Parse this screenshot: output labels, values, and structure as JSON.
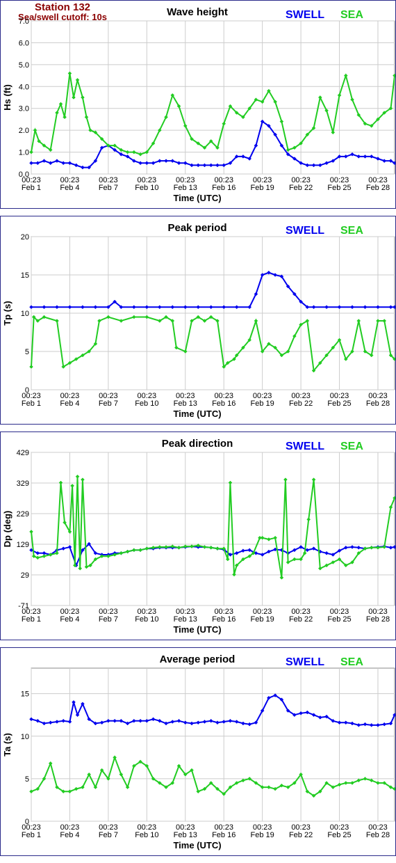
{
  "station": {
    "title": "Station 132",
    "cutoff": "Sea/swell cutoff: 10s"
  },
  "legend": {
    "swell": "SWELL",
    "sea": "SEA"
  },
  "colors": {
    "swell": "#0000ee",
    "sea": "#22cc22",
    "frame": "#2a2a8a",
    "grid": "#cccccc",
    "plot_bg": "#ffffff",
    "station": "#8b0000"
  },
  "x_ticks": [
    {
      "top": "00:23",
      "bottom": "Feb 1"
    },
    {
      "top": "00:23",
      "bottom": "Feb 4"
    },
    {
      "top": "00:23",
      "bottom": "Feb 7"
    },
    {
      "top": "00:23",
      "bottom": "Feb 10"
    },
    {
      "top": "00:23",
      "bottom": "Feb 13"
    },
    {
      "top": "00:23",
      "bottom": "Feb 16"
    },
    {
      "top": "00:23",
      "bottom": "Feb 19"
    },
    {
      "top": "00:23",
      "bottom": "Feb 22"
    },
    {
      "top": "00:23",
      "bottom": "Feb 25"
    },
    {
      "top": "00:23",
      "bottom": "Feb 28"
    }
  ],
  "chart_data": [
    {
      "type": "line",
      "title": "Wave height",
      "xlabel": "Time (UTC)",
      "ylabel": "Hs (ft)",
      "ylim": [
        0,
        7
      ],
      "yticks": [
        "0.0",
        "1.0",
        "2.0",
        "3.0",
        "4.0",
        "5.0",
        "6.0",
        "7.0"
      ],
      "xlim": [
        1,
        29.3
      ],
      "grid": true,
      "legend": "top-right",
      "series": [
        {
          "name": "SWELL",
          "x": [
            1,
            1.5,
            2,
            2.5,
            3,
            3.5,
            4,
            4.5,
            5,
            5.5,
            6,
            6.5,
            7,
            7.5,
            8,
            8.5,
            9,
            9.5,
            10,
            10.5,
            11,
            11.5,
            12,
            12.5,
            13,
            13.5,
            14,
            14.5,
            15,
            15.5,
            16,
            16.5,
            17,
            17.5,
            18,
            18.5,
            19,
            19.5,
            20,
            20.5,
            21,
            21.5,
            22,
            22.5,
            23,
            23.5,
            24,
            24.5,
            25,
            25.5,
            26,
            26.5,
            27,
            27.5,
            28,
            28.5,
            29,
            29.3
          ],
          "values": [
            0.5,
            0.5,
            0.6,
            0.5,
            0.6,
            0.5,
            0.5,
            0.4,
            0.3,
            0.3,
            0.6,
            1.2,
            1.3,
            1.1,
            0.9,
            0.8,
            0.6,
            0.5,
            0.5,
            0.5,
            0.6,
            0.6,
            0.6,
            0.5,
            0.5,
            0.4,
            0.4,
            0.4,
            0.4,
            0.4,
            0.4,
            0.5,
            0.8,
            0.8,
            0.7,
            1.3,
            2.4,
            2.2,
            1.8,
            1.3,
            0.9,
            0.7,
            0.5,
            0.4,
            0.4,
            0.4,
            0.5,
            0.6,
            0.8,
            0.8,
            0.9,
            0.8,
            0.8,
            0.8,
            0.7,
            0.6,
            0.6,
            0.5
          ]
        },
        {
          "name": "SEA",
          "x": [
            1,
            1.3,
            1.6,
            2,
            2.5,
            3,
            3.3,
            3.6,
            4,
            4.3,
            4.6,
            5,
            5.3,
            5.6,
            6,
            6.5,
            7,
            7.5,
            8,
            8.5,
            9,
            9.5,
            10,
            10.5,
            11,
            11.5,
            12,
            12.5,
            13,
            13.5,
            14,
            14.5,
            15,
            15.5,
            16,
            16.5,
            17,
            17.5,
            18,
            18.5,
            19,
            19.5,
            20,
            20.5,
            21,
            21.5,
            22,
            22.5,
            23,
            23.5,
            24,
            24.5,
            25,
            25.5,
            26,
            26.5,
            27,
            27.5,
            28,
            28.5,
            29,
            29.3
          ],
          "values": [
            1.0,
            2.0,
            1.5,
            1.3,
            1.1,
            2.8,
            3.2,
            2.6,
            4.6,
            3.5,
            4.3,
            3.5,
            2.6,
            2.0,
            1.9,
            1.6,
            1.3,
            1.3,
            1.1,
            1.0,
            1.0,
            0.9,
            1.0,
            1.4,
            2.0,
            2.6,
            3.6,
            3.1,
            2.2,
            1.6,
            1.4,
            1.2,
            1.5,
            1.2,
            2.3,
            3.1,
            2.8,
            2.6,
            3.0,
            3.4,
            3.3,
            3.8,
            3.3,
            2.4,
            1.1,
            1.2,
            1.4,
            1.8,
            2.1,
            3.5,
            2.9,
            1.9,
            3.6,
            4.5,
            3.4,
            2.7,
            2.3,
            2.2,
            2.5,
            2.8,
            3.0,
            4.5
          ]
        }
      ]
    },
    {
      "type": "line",
      "title": "Peak period",
      "xlabel": "Time (UTC)",
      "ylabel": "Tp (s)",
      "ylim": [
        0,
        20
      ],
      "yticks": [
        "0",
        "5",
        "10",
        "15",
        "20"
      ],
      "xlim": [
        1,
        29.3
      ],
      "grid": true,
      "legend": "top-right",
      "series": [
        {
          "name": "SWELL",
          "x": [
            1,
            2,
            3,
            4,
            5,
            6,
            7,
            7.5,
            8,
            9,
            10,
            11,
            12,
            13,
            14,
            15,
            16,
            17,
            18,
            18.5,
            19,
            19.5,
            20,
            20.5,
            21,
            21.5,
            22,
            22.5,
            23,
            24,
            25,
            26,
            27,
            28,
            29,
            29.3
          ],
          "values": [
            10.8,
            10.8,
            10.8,
            10.8,
            10.8,
            10.8,
            10.8,
            11.5,
            10.8,
            10.8,
            10.8,
            10.8,
            10.8,
            10.8,
            10.8,
            10.8,
            10.8,
            10.8,
            10.8,
            12.5,
            15.0,
            15.3,
            15.0,
            14.8,
            13.5,
            12.5,
            11.5,
            10.8,
            10.8,
            10.8,
            10.8,
            10.8,
            10.8,
            10.8,
            10.8,
            10.8
          ]
        },
        {
          "name": "SEA",
          "x": [
            1,
            1.2,
            1.5,
            2,
            3,
            3.5,
            4,
            4.5,
            5,
            5.5,
            6,
            6.3,
            7,
            8,
            9,
            10,
            11,
            11.5,
            12,
            12.3,
            13,
            13.5,
            14,
            14.5,
            15,
            15.5,
            16,
            16.3,
            16.8,
            17,
            17.5,
            18,
            18.5,
            19,
            19.5,
            20,
            20.5,
            21,
            21.5,
            22,
            22.5,
            23,
            23.5,
            24,
            24.5,
            25,
            25.5,
            26,
            26.5,
            27,
            27.5,
            28,
            28.5,
            29,
            29.3
          ],
          "values": [
            3.0,
            9.5,
            9.0,
            9.5,
            9.0,
            3.0,
            3.5,
            4.0,
            4.5,
            5.0,
            6.0,
            9.0,
            9.5,
            9.0,
            9.5,
            9.5,
            9.0,
            9.5,
            9.0,
            5.5,
            5.0,
            9.0,
            9.5,
            9.0,
            9.5,
            9.0,
            3.0,
            3.5,
            4.0,
            4.5,
            5.5,
            6.5,
            9.0,
            5.0,
            6.0,
            5.5,
            4.5,
            5.0,
            7.0,
            8.5,
            9.0,
            2.5,
            3.5,
            4.5,
            5.5,
            6.5,
            4.0,
            5.0,
            9.0,
            5.0,
            4.5,
            9.0,
            9.0,
            4.5,
            4.0
          ]
        }
      ]
    },
    {
      "type": "line",
      "title": "Peak direction",
      "xlabel": "Time (UTC)",
      "ylabel": "Dp (deg)",
      "ylim": [
        -71,
        429
      ],
      "yticks": [
        "-71",
        "29",
        "129",
        "229",
        "329",
        "429"
      ],
      "xlim": [
        1,
        29.3
      ],
      "grid": true,
      "legend": "top-right",
      "series": [
        {
          "name": "SWELL",
          "x": [
            1,
            1.5,
            2,
            2.5,
            3,
            3.5,
            4,
            4.5,
            5,
            5.5,
            6,
            6.5,
            7,
            7.5,
            8,
            8.5,
            9,
            9.5,
            10,
            10.5,
            11,
            11.5,
            12,
            12.5,
            13,
            13.5,
            14,
            14.5,
            15,
            15.5,
            16,
            16.5,
            17,
            17.5,
            18,
            18.5,
            19,
            19.5,
            20,
            20.5,
            21,
            21.5,
            22,
            22.5,
            23,
            23.5,
            24,
            24.5,
            25,
            25.5,
            26,
            26.5,
            27,
            27.5,
            28,
            28.5,
            29,
            29.3
          ],
          "values": [
            110,
            100,
            100,
            95,
            110,
            115,
            120,
            60,
            110,
            130,
            100,
            95,
            95,
            100,
            100,
            105,
            110,
            110,
            115,
            115,
            118,
            118,
            118,
            118,
            120,
            122,
            120,
            120,
            118,
            115,
            112,
            95,
            100,
            108,
            110,
            100,
            95,
            105,
            112,
            110,
            100,
            110,
            120,
            110,
            115,
            105,
            100,
            95,
            108,
            118,
            120,
            118,
            115,
            118,
            120,
            122,
            118,
            120
          ]
        },
        {
          "name": "SEA",
          "x": [
            1,
            1.2,
            1.5,
            2,
            2.5,
            3,
            3.3,
            3.6,
            4,
            4.2,
            4.4,
            4.6,
            4.8,
            5,
            5.3,
            5.6,
            6,
            6.5,
            7,
            7.5,
            8,
            8.5,
            9,
            9.5,
            10,
            10.5,
            11,
            11.5,
            12,
            12.5,
            13,
            13.5,
            14,
            14.5,
            15,
            15.5,
            16,
            16.3,
            16.5,
            16.8,
            17,
            17.5,
            18,
            18.3,
            18.8,
            19,
            19.5,
            20,
            20.5,
            20.8,
            21,
            21.5,
            22,
            22.3,
            22.6,
            23,
            23.5,
            24,
            24.5,
            25,
            25.5,
            26,
            26.5,
            27,
            27.5,
            28,
            28.5,
            29,
            29.3
          ],
          "values": [
            170,
            90,
            85,
            90,
            95,
            100,
            330,
            200,
            170,
            320,
            60,
            350,
            50,
            340,
            55,
            60,
            80,
            90,
            90,
            95,
            100,
            105,
            110,
            110,
            115,
            118,
            120,
            120,
            122,
            118,
            122,
            122,
            125,
            120,
            118,
            115,
            115,
            80,
            330,
            30,
            60,
            80,
            90,
            100,
            150,
            150,
            145,
            150,
            20,
            340,
            70,
            80,
            80,
            100,
            210,
            340,
            50,
            60,
            70,
            80,
            60,
            70,
            100,
            115,
            118,
            118,
            120,
            250,
            280
          ]
        }
      ]
    },
    {
      "type": "line",
      "title": "Average period",
      "xlabel": "Time (UTC)",
      "ylabel": "Ta (s)",
      "ylim": [
        0,
        18
      ],
      "yticks": [
        "0",
        "5",
        "10",
        "15"
      ],
      "xlim": [
        1,
        29.3
      ],
      "grid": true,
      "legend": "top-right",
      "series": [
        {
          "name": "SWELL",
          "x": [
            1,
            1.5,
            2,
            2.5,
            3,
            3.5,
            4,
            4.3,
            4.6,
            5,
            5.5,
            6,
            6.5,
            7,
            7.5,
            8,
            8.5,
            9,
            9.5,
            10,
            10.5,
            11,
            11.5,
            12,
            12.5,
            13,
            13.5,
            14,
            14.5,
            15,
            15.5,
            16,
            16.5,
            17,
            17.5,
            18,
            18.5,
            19,
            19.5,
            20,
            20.5,
            21,
            21.5,
            22,
            22.5,
            23,
            23.5,
            24,
            24.5,
            25,
            25.5,
            26,
            26.5,
            27,
            27.5,
            28,
            28.5,
            29,
            29.3
          ],
          "values": [
            12.0,
            11.8,
            11.5,
            11.6,
            11.7,
            11.8,
            11.7,
            14.0,
            12.5,
            13.8,
            12.0,
            11.5,
            11.6,
            11.8,
            11.8,
            11.8,
            11.5,
            11.8,
            11.8,
            11.8,
            12.0,
            11.8,
            11.5,
            11.7,
            11.8,
            11.6,
            11.5,
            11.6,
            11.7,
            11.8,
            11.6,
            11.7,
            11.8,
            11.7,
            11.5,
            11.4,
            11.6,
            13.0,
            14.5,
            14.8,
            14.3,
            13.0,
            12.5,
            12.7,
            12.8,
            12.5,
            12.2,
            12.3,
            11.8,
            11.6,
            11.6,
            11.5,
            11.3,
            11.4,
            11.3,
            11.3,
            11.4,
            11.5,
            12.5
          ]
        },
        {
          "name": "SEA",
          "x": [
            1,
            1.5,
            2,
            2.5,
            3,
            3.5,
            4,
            4.5,
            5,
            5.5,
            6,
            6.5,
            7,
            7.5,
            8,
            8.5,
            9,
            9.5,
            10,
            10.5,
            11,
            11.5,
            12,
            12.5,
            13,
            13.5,
            14,
            14.5,
            15,
            15.5,
            16,
            16.5,
            17,
            17.5,
            18,
            18.5,
            19,
            19.5,
            20,
            20.5,
            21,
            21.5,
            22,
            22.5,
            23,
            23.5,
            24,
            24.5,
            25,
            25.5,
            26,
            26.5,
            27,
            27.5,
            28,
            28.5,
            29,
            29.3
          ],
          "values": [
            3.5,
            3.8,
            5.0,
            6.8,
            4.0,
            3.5,
            3.5,
            3.8,
            4.0,
            5.5,
            4.0,
            6.0,
            5.0,
            7.5,
            5.5,
            4.0,
            6.5,
            7.0,
            6.5,
            5.0,
            4.5,
            4.0,
            4.5,
            6.5,
            5.5,
            6.0,
            3.5,
            3.8,
            4.5,
            3.8,
            3.2,
            4.0,
            4.5,
            4.8,
            5.0,
            4.5,
            4.0,
            4.0,
            3.8,
            4.2,
            4.0,
            4.5,
            5.5,
            3.5,
            3.0,
            3.5,
            4.5,
            4.0,
            4.3,
            4.5,
            4.5,
            4.8,
            5.0,
            4.8,
            4.5,
            4.5,
            4.0,
            3.8
          ]
        }
      ]
    }
  ]
}
